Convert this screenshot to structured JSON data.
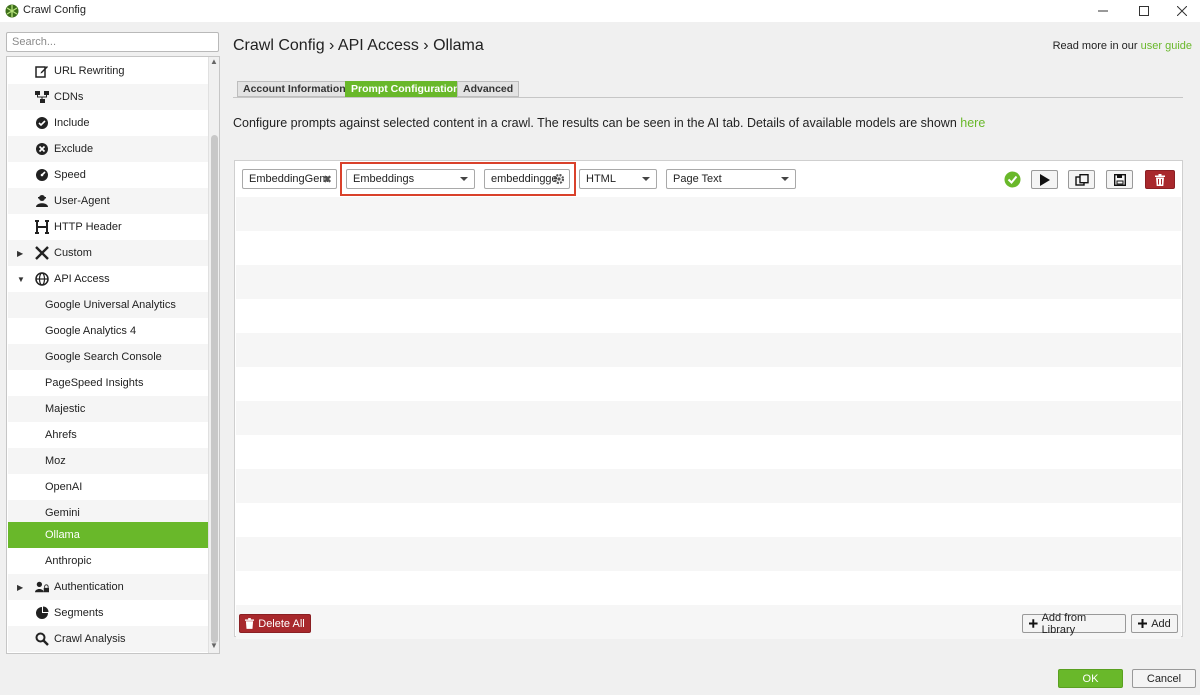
{
  "window": {
    "title": "Crawl Config",
    "minimize_icon": "minimize-icon",
    "maximize_icon": "maximize-icon",
    "close_icon": "close-icon"
  },
  "search": {
    "placeholder": "Search..."
  },
  "sidebar": {
    "items": [
      {
        "label": "URL Rewriting",
        "icon": "edit-icon"
      },
      {
        "label": "CDNs",
        "icon": "network-icon"
      },
      {
        "label": "Include",
        "icon": "check-circle-icon"
      },
      {
        "label": "Exclude",
        "icon": "x-circle-icon"
      },
      {
        "label": "Speed",
        "icon": "speedometer-icon"
      },
      {
        "label": "User-Agent",
        "icon": "user-agent-icon"
      },
      {
        "label": "HTTP Header",
        "icon": "header-h-icon"
      },
      {
        "label": "Custom",
        "icon": "tools-icon",
        "expandable": true,
        "expanded": false
      },
      {
        "label": "API Access",
        "icon": "globe-icon",
        "expandable": true,
        "expanded": true
      },
      {
        "label": "Google Universal Analytics"
      },
      {
        "label": "Google Analytics 4"
      },
      {
        "label": "Google Search Console"
      },
      {
        "label": "PageSpeed Insights"
      },
      {
        "label": "Majestic"
      },
      {
        "label": "Ahrefs"
      },
      {
        "label": "Moz"
      },
      {
        "label": "OpenAI"
      },
      {
        "label": "Gemini"
      },
      {
        "label": "Ollama",
        "selected": true
      },
      {
        "label": "Anthropic"
      },
      {
        "label": "Authentication",
        "icon": "user-lock-icon",
        "expandable": true,
        "expanded": false
      },
      {
        "label": "Segments",
        "icon": "pie-chart-icon"
      },
      {
        "label": "Crawl Analysis",
        "icon": "search-icon"
      }
    ]
  },
  "header": {
    "breadcrumb": "Crawl Config  ›  API Access  ›  Ollama",
    "guide_prefix": "Read more in our ",
    "guide_link": "user guide"
  },
  "tabs": [
    {
      "label": "Account Information",
      "active": false
    },
    {
      "label": "Prompt Configuration",
      "active": true
    },
    {
      "label": "Advanced",
      "active": false
    }
  ],
  "description": {
    "text": "Configure prompts against selected content in a crawl. The results can be seen in the AI tab. Details of available models are shown ",
    "link": "here"
  },
  "prompt_row": {
    "name": "EmbeddingGem",
    "type": "Embeddings",
    "model": "embeddingge",
    "content_type": "HTML",
    "content_source": "Page Text",
    "status_icon": "check-circle-icon",
    "actions": [
      "play-icon",
      "copy-icon",
      "save-icon",
      "trash-icon"
    ]
  },
  "buttons": {
    "delete_all": "Delete All",
    "add_from_library": "Add from Library",
    "add": "Add",
    "ok": "OK",
    "cancel": "Cancel"
  },
  "colors": {
    "accent": "#69b82a",
    "danger": "#a8282c",
    "highlight": "#d9412b"
  }
}
